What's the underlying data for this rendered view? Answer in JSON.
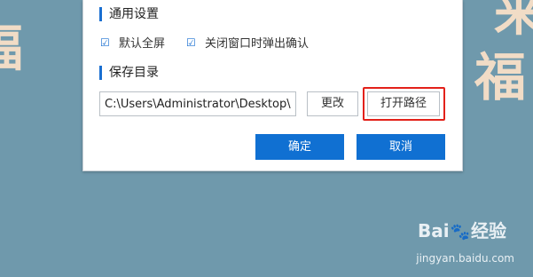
{
  "background": {
    "chars": [
      "福",
      "来",
      "福"
    ]
  },
  "dialog": {
    "general_title": "通用设置",
    "checkboxes": [
      {
        "label": "默认全屏",
        "checked": true
      },
      {
        "label": "关闭窗口时弹出确认",
        "checked": true
      }
    ],
    "save_title": "保存目录",
    "path_value": "C:\\Users\\Administrator\\Desktop\\",
    "change_label": "更改",
    "open_path_label": "打开路径",
    "ok_label": "确定",
    "cancel_label": "取消"
  },
  "watermark": {
    "brand_a": "Bai",
    "paw": "🐾",
    "brand_b": "经验",
    "url": "jingyan.baidu.com"
  },
  "colors": {
    "accent": "#1070d2",
    "highlight": "#e3211a",
    "background": "#6f99ac"
  }
}
